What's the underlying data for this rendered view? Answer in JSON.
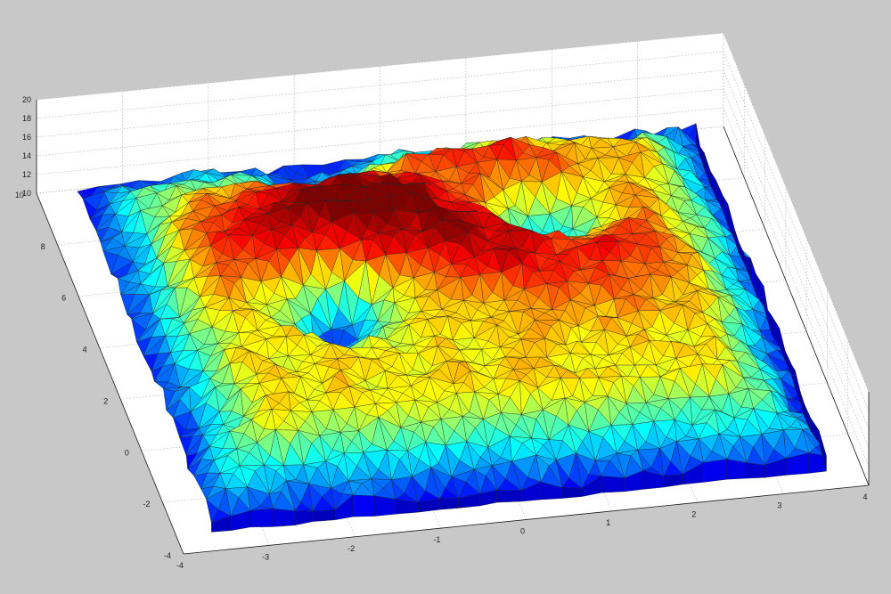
{
  "chart_data": {
    "type": "surface",
    "title": "",
    "xlabel": "",
    "ylabel": "",
    "zlabel": "",
    "x_ticks": [
      "-4",
      "-3",
      "-2",
      "-1",
      "0",
      "1",
      "2",
      "3",
      "4"
    ],
    "y_ticks": [
      "-4",
      "-2",
      "0",
      "2",
      "4",
      "6",
      "8",
      "10"
    ],
    "z_ticks": [
      "10",
      "12",
      "14",
      "16",
      "18",
      "20"
    ],
    "xlim": [
      -4,
      4
    ],
    "ylim": [
      -4,
      10
    ],
    "zlim": [
      10,
      20
    ],
    "grid": true,
    "colormap": "jet",
    "surface": {
      "description_free_note": "",
      "x_range": [
        -3.6,
        3.6
      ],
      "y_range": [
        -3.4,
        9.4
      ],
      "z_range": [
        10.3,
        19.8
      ],
      "peaks": [
        {
          "x": -0.8,
          "y": 5.6,
          "z": 19.4
        },
        {
          "x": 0.3,
          "y": 3.8,
          "z": 19.0
        },
        {
          "x": -2.2,
          "y": 4.8,
          "z": 18.2
        },
        {
          "x": 1.9,
          "y": 3.0,
          "z": 18.3
        },
        {
          "x": 1.2,
          "y": 7.2,
          "z": 18.0
        }
      ],
      "pits": [
        {
          "x": -1.0,
          "y": 7.8,
          "z": 12.2
        },
        {
          "x": 1.3,
          "y": 5.0,
          "z": 11.8
        },
        {
          "x": -1.4,
          "y": 2.6,
          "z": 11.2
        }
      ]
    },
    "colors": {
      "background": "#c8c8c8",
      "axes_face": "#ffffff",
      "axis_color": "#1a1a1a"
    }
  }
}
